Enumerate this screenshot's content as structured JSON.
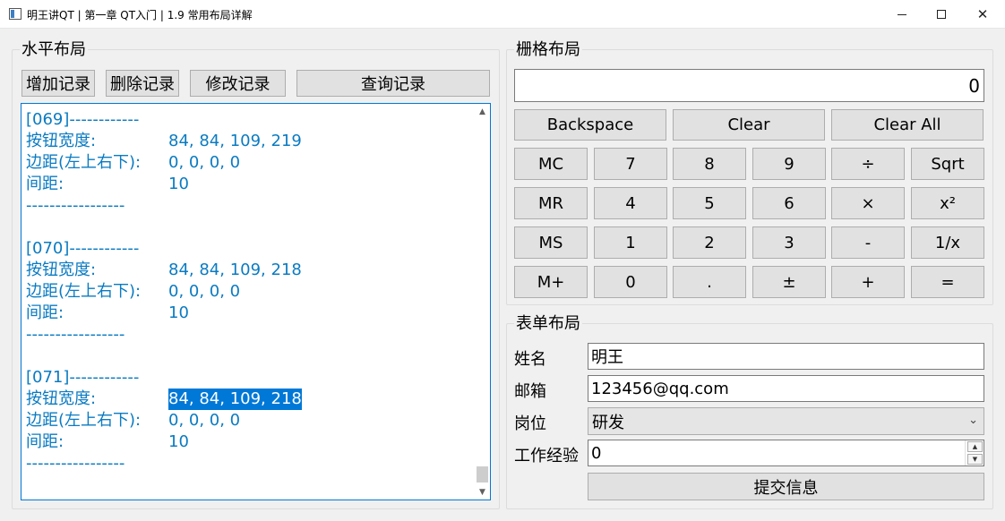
{
  "window": {
    "title": "明王讲QT | 第一章 QT入门 | 1.9 常用布局详解",
    "close_glyph": "✕"
  },
  "hbox": {
    "title": "水平布局",
    "buttons": [
      "增加记录",
      "删除记录",
      "修改记录",
      "查询记录"
    ]
  },
  "log": {
    "lines": [
      {
        "key": "[069]------------",
        "val": ""
      },
      {
        "key": "按钮宽度:",
        "val": "84, 84, 109, 219"
      },
      {
        "key": "边距(左上右下):",
        "val": "0, 0, 0, 0"
      },
      {
        "key": "间距:",
        "val": "10"
      },
      {
        "key": "-----------------",
        "val": ""
      },
      {
        "key": "",
        "val": ""
      },
      {
        "key": "[070]------------",
        "val": ""
      },
      {
        "key": "按钮宽度:",
        "val": "84, 84, 109, 218"
      },
      {
        "key": "边距(左上右下):",
        "val": "0, 0, 0, 0"
      },
      {
        "key": "间距:",
        "val": "10"
      },
      {
        "key": "-----------------",
        "val": ""
      },
      {
        "key": "",
        "val": ""
      },
      {
        "key": "[071]------------",
        "val": ""
      },
      {
        "key": "按钮宽度:",
        "val": "84, 84, 109, 218",
        "selected": true
      },
      {
        "key": "边距(左上右下):",
        "val": "0, 0, 0, 0"
      },
      {
        "key": "间距:",
        "val": "10"
      },
      {
        "key": "-----------------",
        "val": ""
      }
    ]
  },
  "grid": {
    "title": "栅格布局",
    "display": "0",
    "top_buttons": [
      "Backspace",
      "Clear",
      "Clear All"
    ],
    "rows": [
      [
        "MC",
        "7",
        "8",
        "9",
        "÷",
        "Sqrt"
      ],
      [
        "MR",
        "4",
        "5",
        "6",
        "×",
        "x²"
      ],
      [
        "MS",
        "1",
        "2",
        "3",
        "-",
        "1/x"
      ],
      [
        "M+",
        "0",
        ".",
        "±",
        "+",
        "="
      ]
    ]
  },
  "form": {
    "title": "表单布局",
    "name_label": "姓名",
    "name_value": "明王",
    "email_label": "邮箱",
    "email_value": "123456@qq.com",
    "post_label": "岗位",
    "post_value": "研发",
    "exp_label": "工作经验",
    "exp_value": "0",
    "submit": "提交信息"
  },
  "colors": {
    "log_text": "#0a7bc2",
    "selection": "#0078d7",
    "button_bg": "#e1e1e1"
  }
}
